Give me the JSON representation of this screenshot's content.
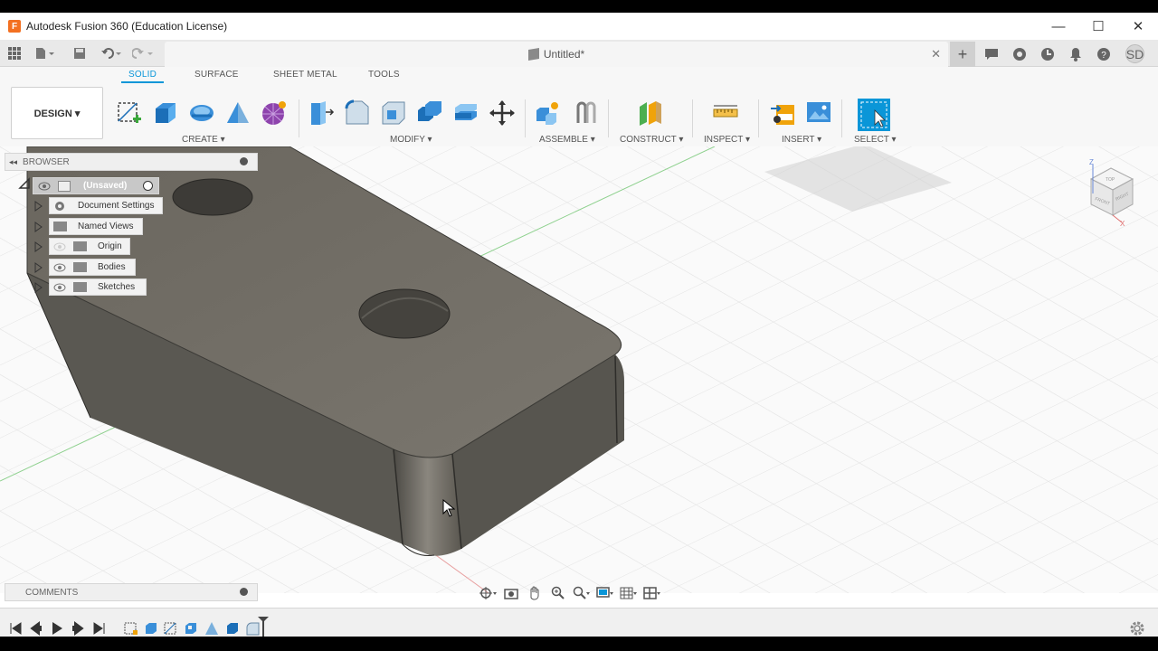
{
  "window": {
    "title": "Autodesk Fusion 360 (Education License)",
    "logo_letter": "F",
    "controls": [
      "—",
      "☐",
      "✕"
    ]
  },
  "document_tab": {
    "name": "Untitled*",
    "close": "✕"
  },
  "quick_access": {
    "plus": "+",
    "user_initials": "SD"
  },
  "ribbon": {
    "tabs": [
      "SOLID",
      "SURFACE",
      "SHEET METAL",
      "TOOLS"
    ],
    "active_tab": "SOLID",
    "workspace_button": "DESIGN ▾",
    "groups": [
      "CREATE ▾",
      "MODIFY ▾",
      "ASSEMBLE ▾",
      "CONSTRUCT ▾",
      "INSPECT ▾",
      "INSERT ▾",
      "SELECT ▾"
    ]
  },
  "browser": {
    "header": "BROWSER",
    "items": [
      {
        "label": "(Unsaved)"
      },
      {
        "label": "Document Settings"
      },
      {
        "label": "Named Views"
      },
      {
        "label": "Origin"
      },
      {
        "label": "Bodies"
      },
      {
        "label": "Sketches"
      }
    ]
  },
  "comments": {
    "header": "COMMENTS"
  },
  "viewcube": {
    "face_front": "FRONT",
    "face_right": "RIGHT",
    "face_top": "TOP",
    "axis_z": "Z",
    "axis_x": "X"
  },
  "colors": {
    "accent": "#0a96d8",
    "body": "#6f6b63",
    "grid": "#e3e3e3",
    "axis_green": "#8fd18f",
    "axis_red": "#e8a0a0"
  }
}
